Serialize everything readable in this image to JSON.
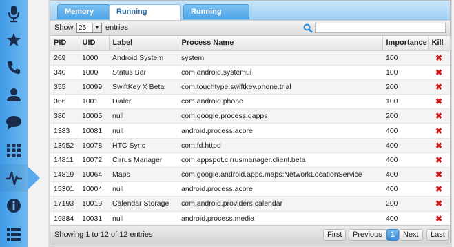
{
  "sidebar": {
    "items": [
      {
        "icon": "microphone-icon"
      },
      {
        "icon": "star-icon"
      },
      {
        "icon": "phone-icon"
      },
      {
        "icon": "contact-icon"
      },
      {
        "icon": "chat-bubble-icon"
      },
      {
        "icon": "grid-icon"
      },
      {
        "icon": "pulse-icon",
        "active": true
      },
      {
        "icon": "info-icon"
      },
      {
        "icon": "list-icon"
      }
    ],
    "accent": "#3f9be6"
  },
  "tabs": [
    {
      "label": "Memory Info"
    },
    {
      "label": "Running Processes",
      "active": true
    },
    {
      "label": "Running Services"
    }
  ],
  "toolbar": {
    "show_label": "Show",
    "page_size": "25",
    "entries_label": "entries",
    "search_value": "",
    "search_placeholder": ""
  },
  "table": {
    "columns": [
      "PID",
      "UID",
      "Label",
      "Process Name",
      "Importance",
      "Kill"
    ],
    "rows": [
      [
        "269",
        "1000",
        "Android System",
        "system",
        "100"
      ],
      [
        "340",
        "1000",
        "Status Bar",
        "com.android.systemui",
        "100"
      ],
      [
        "355",
        "10099",
        "SwiftKey X Beta",
        "com.touchtype.swiftkey.phone.trial",
        "200"
      ],
      [
        "366",
        "1001",
        "Dialer",
        "com.android.phone",
        "100"
      ],
      [
        "380",
        "10005",
        "null",
        "com.google.process.gapps",
        "200"
      ],
      [
        "1383",
        "10081",
        "null",
        "android.process.acore",
        "400"
      ],
      [
        "13952",
        "10078",
        "HTC Sync",
        "com.fd.httpd",
        "400"
      ],
      [
        "14811",
        "10072",
        "Cirrus Manager",
        "com.appspot.cirrusmanager.client.beta",
        "400"
      ],
      [
        "14819",
        "10064",
        "Maps",
        "com.google.android.apps.maps:NetworkLocationService",
        "400"
      ],
      [
        "15301",
        "10004",
        "null",
        "android.process.acore",
        "400"
      ],
      [
        "17193",
        "10019",
        "Calendar Storage",
        "com.android.providers.calendar",
        "200"
      ],
      [
        "19884",
        "10031",
        "null",
        "android.process.media",
        "400"
      ]
    ],
    "kill_icon": "close-x-icon",
    "kill_color": "#cc1a1a"
  },
  "footer": {
    "showing_text": "Showing 1 to 12 of 12 entries",
    "first_label": "First",
    "previous_label": "Previous",
    "current_page": "1",
    "next_label": "Next",
    "last_label": "Last"
  }
}
